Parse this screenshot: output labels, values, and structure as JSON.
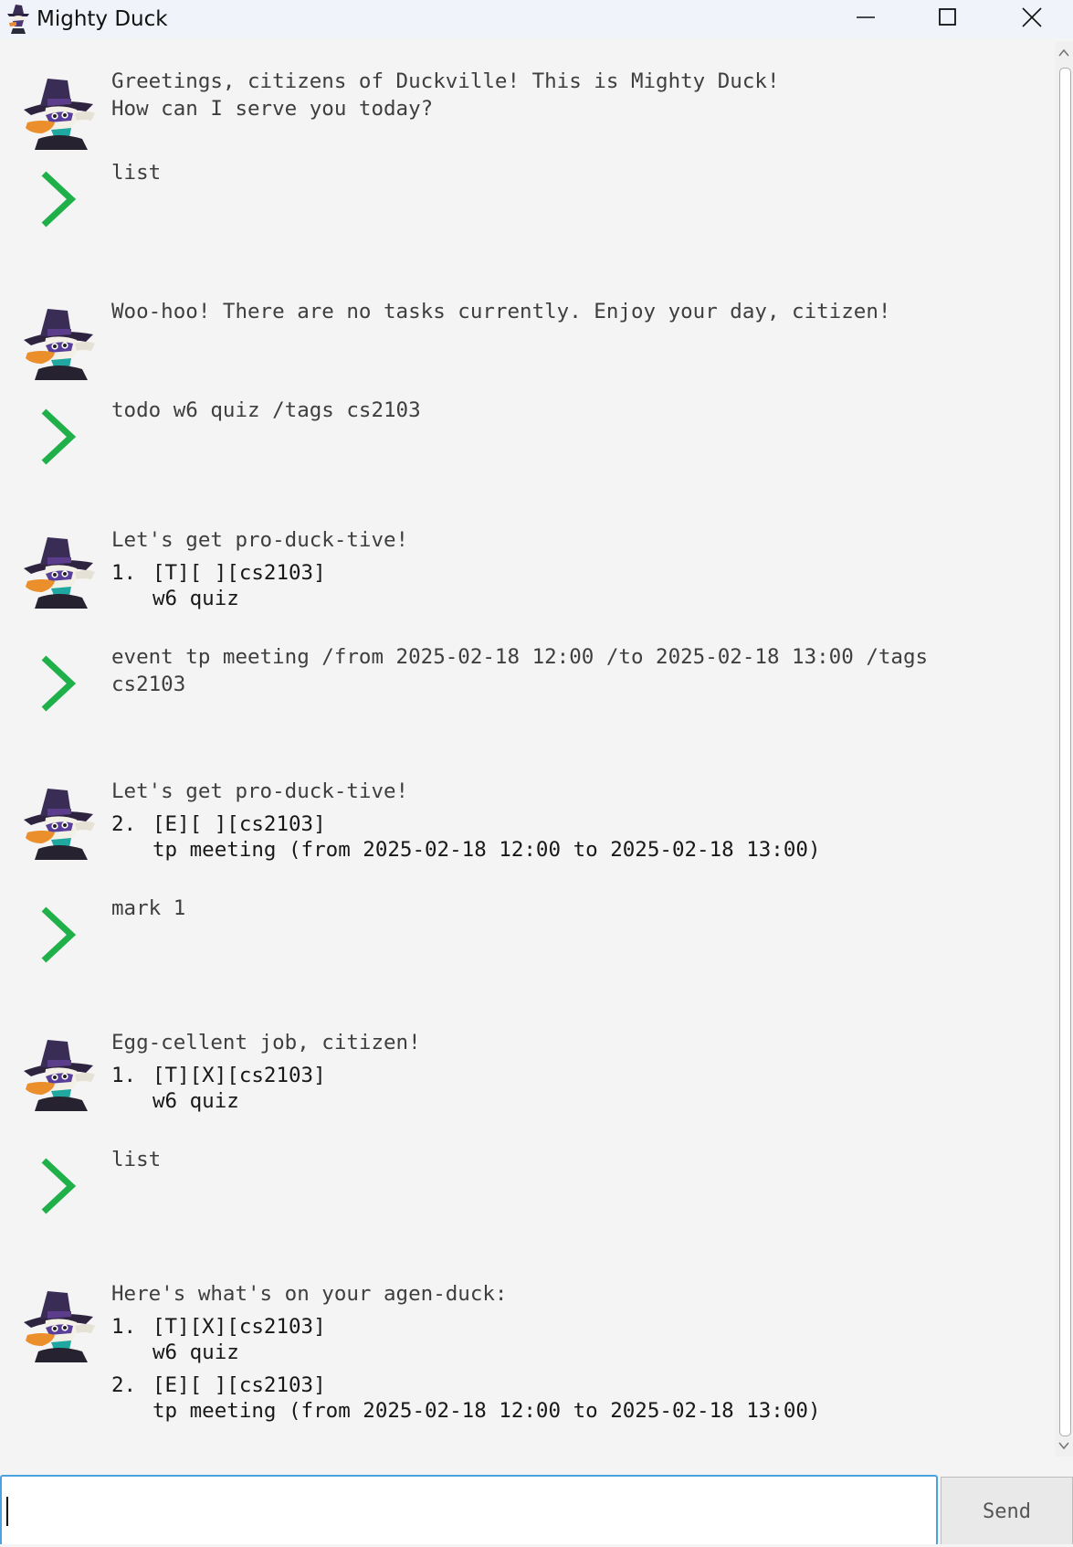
{
  "window": {
    "title": "Mighty Duck"
  },
  "icons": {
    "app": "mighty-duck-app-icon",
    "minimize": "minimize-icon",
    "maximize": "maximize-icon",
    "close": "close-icon",
    "user": "chevron-right-icon",
    "bot": "darkwing-duck-avatar"
  },
  "colors": {
    "accent": "#20b04a",
    "background": "#f4f4f4",
    "input_border": "#4aa3df"
  },
  "conversation": [
    {
      "role": "bot",
      "head": "Greetings, citizens of Duckville! This is Mighty Duck!\nHow can I serve you today?",
      "items": []
    },
    {
      "role": "user",
      "text": "list"
    },
    {
      "role": "bot",
      "head": "Woo-hoo! There are no tasks currently. Enjoy your day, citizen!",
      "items": []
    },
    {
      "role": "user",
      "text": "todo w6 quiz /tags cs2103"
    },
    {
      "role": "bot",
      "head": "Let's get pro-duck-tive!",
      "items": [
        {
          "num": "1.",
          "tag": "[T][ ][cs2103]",
          "desc": "w6 quiz"
        }
      ]
    },
    {
      "role": "user",
      "text": "event tp meeting /from 2025-02-18 12:00 /to 2025-02-18 13:00 /tags\ncs2103"
    },
    {
      "role": "bot",
      "head": "Let's get pro-duck-tive!",
      "items": [
        {
          "num": "2.",
          "tag": "[E][ ][cs2103]",
          "desc": "tp meeting (from 2025-02-18 12:00 to 2025-02-18 13:00)"
        }
      ]
    },
    {
      "role": "user",
      "text": "mark 1"
    },
    {
      "role": "bot",
      "head": "Egg-cellent job, citizen!",
      "items": [
        {
          "num": "1.",
          "tag": "[T][X][cs2103]",
          "desc": "w6 quiz"
        }
      ]
    },
    {
      "role": "user",
      "text": "list"
    },
    {
      "role": "bot",
      "head": "Here's what's on your agen-duck:",
      "items": [
        {
          "num": "1.",
          "tag": "[T][X][cs2103]",
          "desc": "w6 quiz"
        },
        {
          "num": "2.",
          "tag": "[E][ ][cs2103]",
          "desc": "tp meeting (from 2025-02-18 12:00 to 2025-02-18 13:00)"
        }
      ]
    }
  ],
  "input": {
    "value": "",
    "placeholder": ""
  },
  "send_label": "Send"
}
